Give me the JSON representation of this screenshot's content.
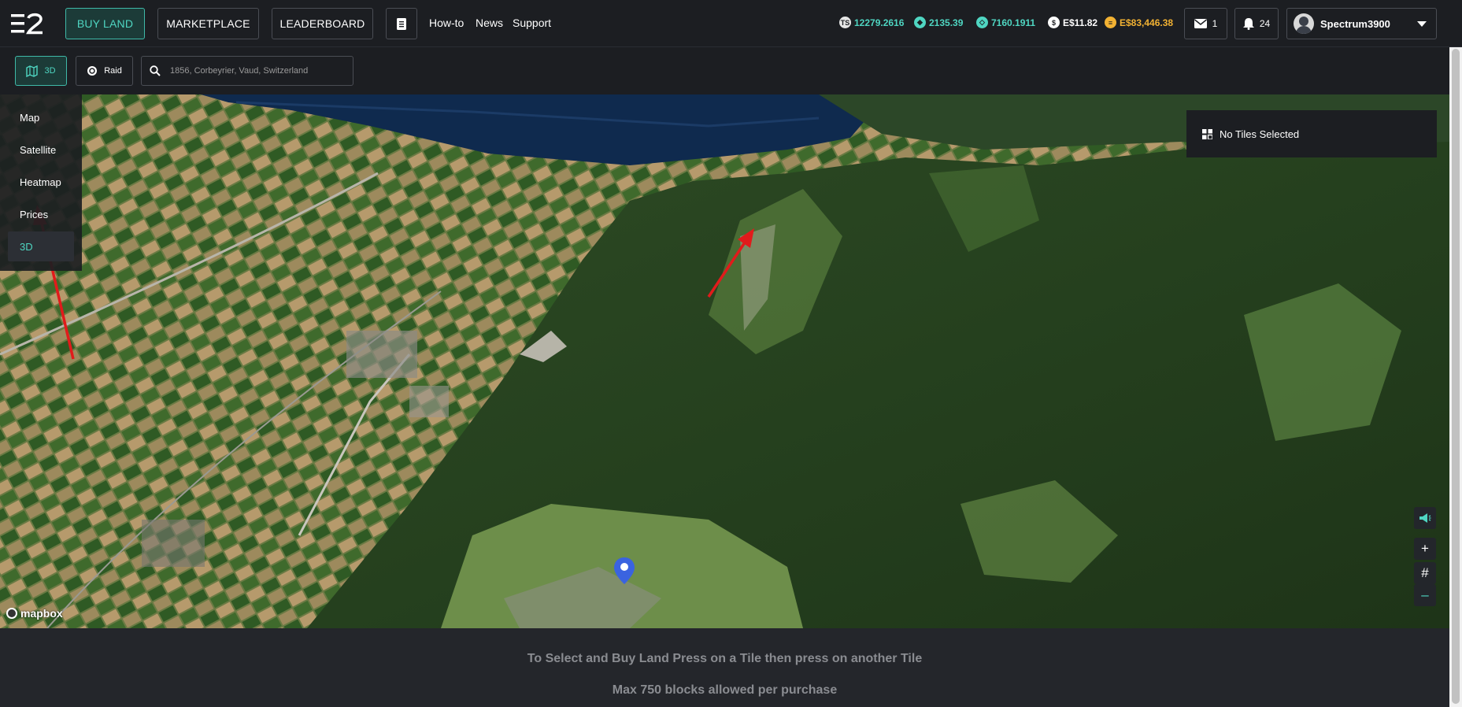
{
  "nav": {
    "buy_land": "BUY LAND",
    "marketplace": "MARKETPLACE",
    "leaderboard": "LEADERBOARD",
    "howto": "How-to",
    "news": "News",
    "support": "Support"
  },
  "stats": {
    "ts": "12279.2616",
    "gem": "2135.39",
    "coin": "7160.1911",
    "dollar": "E$11.82",
    "gold": "E$83,446.38"
  },
  "header": {
    "mail_count": "1",
    "notif_count": "24",
    "username": "Spectrum3900"
  },
  "toolbar": {
    "view_label": "3D",
    "raid_label": "Raid",
    "search_placeholder": "1856, Corbeyrier, Vaud, Switzerland"
  },
  "layers": [
    "Map",
    "Satellite",
    "Heatmap",
    "Prices",
    "3D"
  ],
  "tiles_panel": {
    "label": "No Tiles Selected"
  },
  "map_controls": {
    "zoom_in": "+",
    "grid": "#",
    "zoom_out": "–"
  },
  "attribution": "mapbox",
  "footer": {
    "line1": "To Select and Buy Land Press on a Tile then press on another Tile",
    "line2": "Max 750 blocks allowed per purchase"
  },
  "colors": {
    "accent": "#4fd6c2",
    "gold": "#f2b233",
    "annotation_arrow": "#e11b1b",
    "marker": "#3a63e0"
  }
}
